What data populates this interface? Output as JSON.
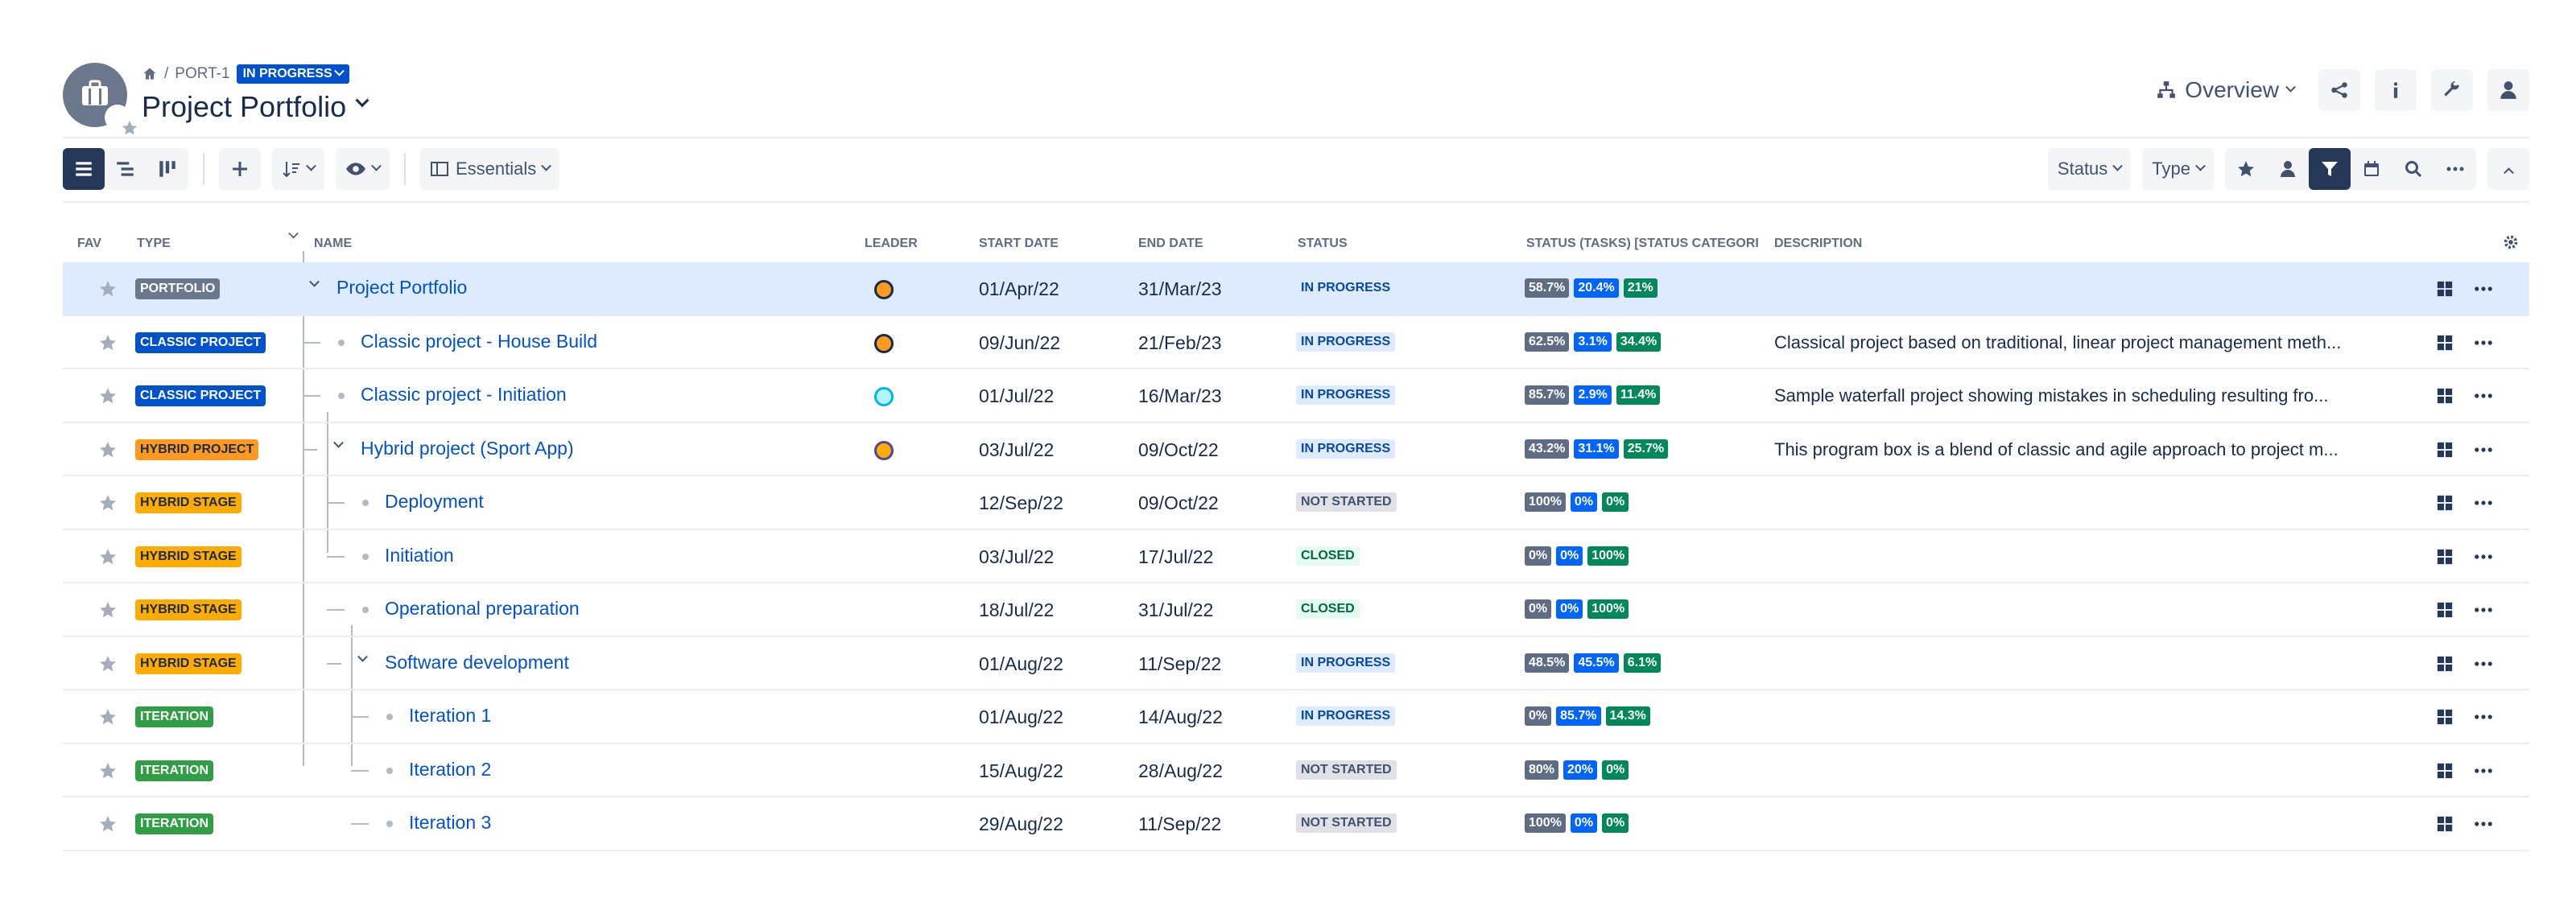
{
  "header": {
    "breadcrumb_key": "PORT-1",
    "breadcrumb_status": "IN PROGRESS",
    "title": "Project Portfolio",
    "overview_label": "Overview"
  },
  "toolbar": {
    "view_label": "Essentials",
    "status_filter": "Status",
    "type_filter": "Type"
  },
  "columns": {
    "fav": "FAV",
    "type": "TYPE",
    "name": "NAME",
    "leader": "LEADER",
    "start": "START DATE",
    "end": "END DATE",
    "status": "STATUS",
    "status_tasks": "STATUS (TASKS) [STATUS CATEGORIES",
    "description": "DESCRIPTION"
  },
  "rows": [
    {
      "type": "PORTFOLIO",
      "name": "Project Portfolio",
      "start": "01/Apr/22",
      "end": "31/Mar/23",
      "status": "IN PROGRESS",
      "p1": "58.7%",
      "p2": "20.4%",
      "p3": "21%",
      "description": ""
    },
    {
      "type": "CLASSIC PROJECT",
      "name": "Classic project - House Build",
      "start": "09/Jun/22",
      "end": "21/Feb/23",
      "status": "IN PROGRESS",
      "p1": "62.5%",
      "p2": "3.1%",
      "p3": "34.4%",
      "description": "Classical project based on traditional, linear project management meth..."
    },
    {
      "type": "CLASSIC PROJECT",
      "name": "Classic project - Initiation",
      "start": "01/Jul/22",
      "end": "16/Mar/23",
      "status": "IN PROGRESS",
      "p1": "85.7%",
      "p2": "2.9%",
      "p3": "11.4%",
      "description": "Sample waterfall project showing mistakes in scheduling resulting fro..."
    },
    {
      "type": "HYBRID PROJECT",
      "name": "Hybrid project (Sport App)",
      "start": "03/Jul/22",
      "end": "09/Oct/22",
      "status": "IN PROGRESS",
      "p1": "43.2%",
      "p2": "31.1%",
      "p3": "25.7%",
      "description": "This program box is a blend of classic and agile approach to project m..."
    },
    {
      "type": "HYBRID STAGE",
      "name": "Deployment",
      "start": "12/Sep/22",
      "end": "09/Oct/22",
      "status": "NOT STARTED",
      "p1": "100%",
      "p2": "0%",
      "p3": "0%",
      "description": ""
    },
    {
      "type": "HYBRID STAGE",
      "name": "Initiation",
      "start": "03/Jul/22",
      "end": "17/Jul/22",
      "status": "CLOSED",
      "p1": "0%",
      "p2": "0%",
      "p3": "100%",
      "description": ""
    },
    {
      "type": "HYBRID STAGE",
      "name": "Operational preparation",
      "start": "18/Jul/22",
      "end": "31/Jul/22",
      "status": "CLOSED",
      "p1": "0%",
      "p2": "0%",
      "p3": "100%",
      "description": ""
    },
    {
      "type": "HYBRID STAGE",
      "name": "Software development",
      "start": "01/Aug/22",
      "end": "11/Sep/22",
      "status": "IN PROGRESS",
      "p1": "48.5%",
      "p2": "45.5%",
      "p3": "6.1%",
      "description": ""
    },
    {
      "type": "ITERATION",
      "name": "Iteration 1",
      "start": "01/Aug/22",
      "end": "14/Aug/22",
      "status": "IN PROGRESS",
      "p1": "0%",
      "p2": "85.7%",
      "p3": "14.3%",
      "description": ""
    },
    {
      "type": "ITERATION",
      "name": "Iteration 2",
      "start": "15/Aug/22",
      "end": "28/Aug/22",
      "status": "NOT STARTED",
      "p1": "80%",
      "p2": "20%",
      "p3": "0%",
      "description": ""
    },
    {
      "type": "ITERATION",
      "name": "Iteration 3",
      "start": "29/Aug/22",
      "end": "11/Sep/22",
      "status": "NOT STARTED",
      "p1": "100%",
      "p2": "0%",
      "p3": "0%",
      "description": ""
    }
  ],
  "colors": {
    "accent": "#0052cc",
    "selected_row": "#deebff"
  }
}
